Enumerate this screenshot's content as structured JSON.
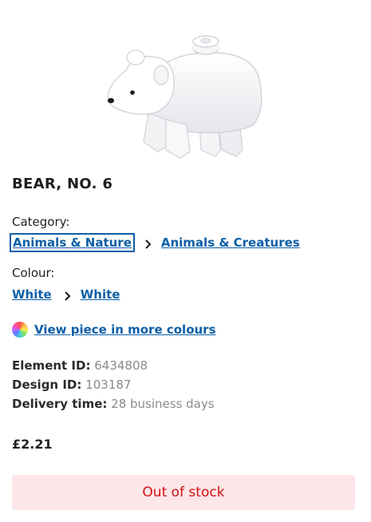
{
  "product": {
    "title": "BEAR, NO. 6",
    "image_icon": "white-bear-brick-icon"
  },
  "category": {
    "label": "Category:",
    "crumbs": [
      "Animals & Nature",
      "Animals & Creatures"
    ]
  },
  "colour": {
    "label": "Colour:",
    "crumbs": [
      "White",
      "White"
    ]
  },
  "more_colours": {
    "link": "View piece in more colours",
    "icon": "colour-wheel-icon"
  },
  "details": {
    "element_id_label": "Element ID:",
    "element_id": "6434808",
    "design_id_label": "Design ID:",
    "design_id": "103187",
    "delivery_label": "Delivery time:",
    "delivery": "28 business days"
  },
  "price": "£2.21",
  "stock": {
    "status": "Out of stock",
    "bg_color": "#fde6e7",
    "text_color": "#d01012"
  },
  "colors": {
    "link": "#0d5fa6"
  }
}
